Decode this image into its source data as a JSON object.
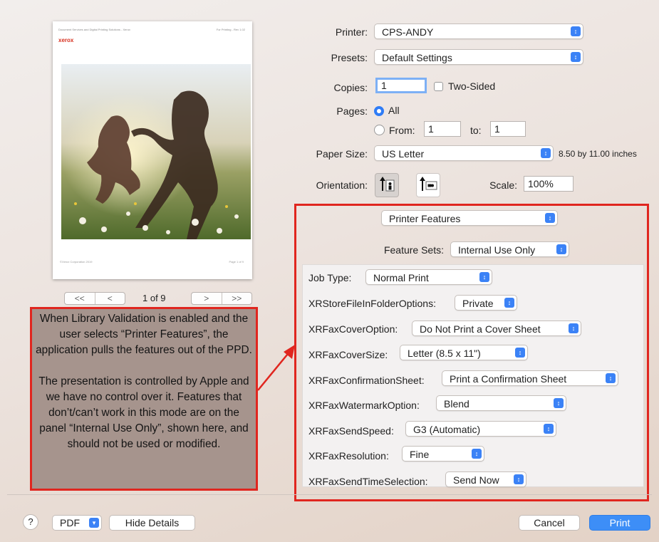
{
  "preview": {
    "header_left": "Document Services and Digital Printing Solutions - Xerox",
    "header_right": "For Printing - Rev 1.02",
    "logo": "xerox",
    "footer_left": "©Xerox Corporation 2019",
    "footer_right": "Page 1 of 9",
    "nav": {
      "first": "<<",
      "prev": "<",
      "next": ">",
      "last": ">>"
    },
    "page_indicator": "1 of 9"
  },
  "callout": {
    "para1": "When Library Validation is enabled and the user selects “Printer Features”, the application pulls the features out of the PPD.",
    "para2": "The presentation is controlled by Apple and we have no control over it. Features that don’t/can’t work in this mode are on the panel “Internal Use Only”, shown here, and should not be used or modified."
  },
  "form": {
    "printer": {
      "label": "Printer:",
      "value": "CPS-ANDY"
    },
    "presets": {
      "label": "Presets:",
      "value": "Default Settings"
    },
    "copies": {
      "label": "Copies:",
      "value": "1"
    },
    "two_sided": {
      "label": "Two-Sided",
      "checked": false
    },
    "pages": {
      "label": "Pages:",
      "all": "All",
      "from_label": "From:",
      "from_value": "1",
      "to_label": "to:",
      "to_value": "1",
      "selected": "All"
    },
    "paper_size": {
      "label": "Paper Size:",
      "value": "US Letter",
      "dimensions": "8.50 by 11.00 inches"
    },
    "orientation": {
      "label": "Orientation:",
      "selected": "portrait"
    },
    "scale": {
      "label": "Scale:",
      "value": "100%"
    }
  },
  "features": {
    "section": "Printer Features",
    "feature_sets": {
      "label": "Feature Sets:",
      "value": "Internal Use Only"
    },
    "rows": [
      {
        "label": "Job Type:",
        "value": "Normal Print"
      },
      {
        "label": "XRStoreFileInFolderOptions:",
        "value": "Private"
      },
      {
        "label": "XRFaxCoverOption:",
        "value": "Do Not Print a Cover Sheet"
      },
      {
        "label": "XRFaxCoverSize:",
        "value": "Letter (8.5 x 11\")"
      },
      {
        "label": "XRFaxConfirmationSheet:",
        "value": "Print a Confirmation Sheet"
      },
      {
        "label": "XRFaxWatermarkOption:",
        "value": "Blend"
      },
      {
        "label": "XRFaxSendSpeed:",
        "value": "G3 (Automatic)"
      },
      {
        "label": "XRFaxResolution:",
        "value": "Fine"
      },
      {
        "label": "XRFaxSendTimeSelection:",
        "value": "Send Now"
      }
    ]
  },
  "footer": {
    "help": "?",
    "pdf": "PDF",
    "hide_details": "Hide Details",
    "cancel": "Cancel",
    "print": "Print"
  },
  "colors": {
    "accent": "#3d8ef7",
    "annotation_red": "#e0261f",
    "callout_bg": "#a6948d"
  }
}
